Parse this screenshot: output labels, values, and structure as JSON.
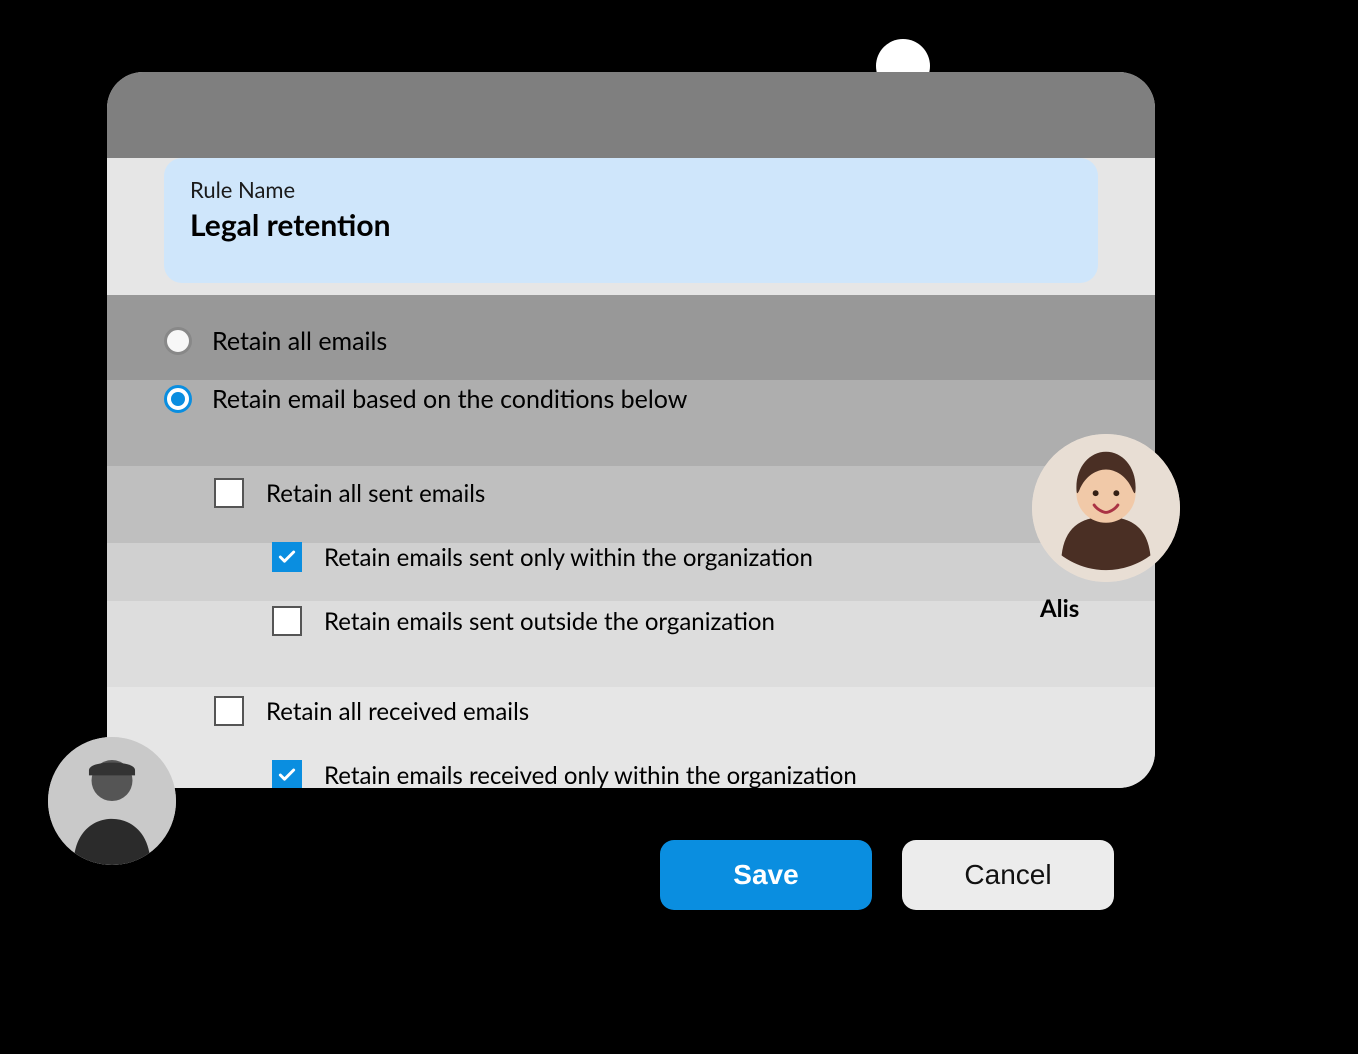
{
  "rule": {
    "label": "Rule Name",
    "value": "Legal retention"
  },
  "radios": {
    "all": {
      "label": "Retain all emails",
      "selected": false
    },
    "conditional": {
      "label": "Retain email based on the conditions below",
      "selected": true
    }
  },
  "checks": {
    "sent_all": {
      "label": "Retain all sent emails",
      "checked": false
    },
    "sent_internal": {
      "label": "Retain emails sent only within the organization",
      "checked": true
    },
    "sent_external": {
      "label": "Retain emails sent outside the organization",
      "checked": false
    },
    "recv_all": {
      "label": "Retain all received emails",
      "checked": false
    },
    "recv_internal": {
      "label": "Retain emails received only within the organization",
      "checked": true
    }
  },
  "buttons": {
    "save": "Save",
    "cancel": "Cancel"
  },
  "avatars": {
    "right_name": "Alis"
  }
}
